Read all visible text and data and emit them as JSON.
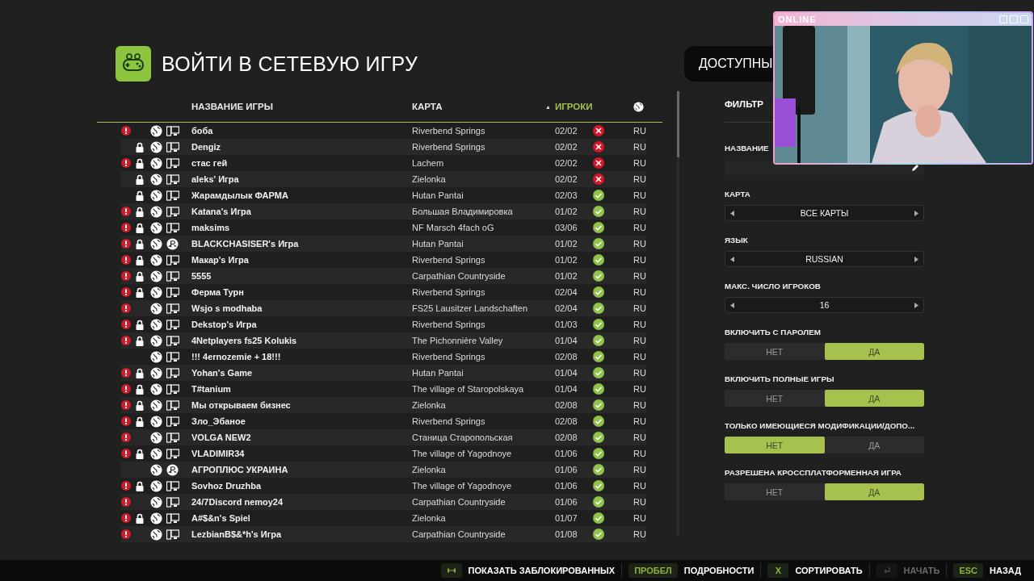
{
  "title": "ВОЙТИ В СЕТЕВУЮ ИГРУ",
  "tab": {
    "label": "ДОСТУПНЫ"
  },
  "table": {
    "columns": {
      "name": "НАЗВАНИЕ ИГРЫ",
      "map": "КАРТА",
      "sort_arrow": "▲",
      "players": "ИГРОКИ"
    },
    "sorted_by_players": true,
    "rows": [
      {
        "name": "боба",
        "map": "Riverbend Springs",
        "players": "02/02",
        "full": true,
        "warning": true,
        "locked": false,
        "console": false,
        "lang": "RU"
      },
      {
        "name": "Dengiz",
        "map": "Riverbend Springs",
        "players": "02/02",
        "full": true,
        "warning": false,
        "locked": true,
        "console": false,
        "lang": "RU"
      },
      {
        "name": "стас гей",
        "map": "Lachem",
        "players": "02/02",
        "full": true,
        "warning": true,
        "locked": true,
        "console": false,
        "lang": "RU"
      },
      {
        "name": "aleks' Игра",
        "map": "Zielonka",
        "players": "02/02",
        "full": true,
        "warning": false,
        "locked": true,
        "console": false,
        "lang": "RU"
      },
      {
        "name": "Жарамдылык ФАРМА",
        "map": "Hutan Pantai",
        "players": "02/03",
        "full": false,
        "warning": false,
        "locked": true,
        "console": false,
        "lang": "RU"
      },
      {
        "name": "Katana's Игра",
        "map": "Большая Владимировка",
        "players": "01/02",
        "full": false,
        "warning": true,
        "locked": true,
        "console": false,
        "lang": "RU"
      },
      {
        "name": "maksims",
        "map": "NF Marsch 4fach oG",
        "players": "03/06",
        "full": false,
        "warning": true,
        "locked": true,
        "console": false,
        "lang": "RU"
      },
      {
        "name": "BLACKCHASISER's Игра",
        "map": "Hutan Pantai",
        "players": "01/02",
        "full": false,
        "warning": true,
        "locked": true,
        "console": true,
        "lang": "RU"
      },
      {
        "name": "Макар's Игра",
        "map": "Riverbend Springs",
        "players": "01/02",
        "full": false,
        "warning": true,
        "locked": true,
        "console": false,
        "lang": "RU"
      },
      {
        "name": "5555",
        "map": "Carpathian Countryside",
        "players": "01/02",
        "full": false,
        "warning": true,
        "locked": true,
        "console": false,
        "lang": "RU"
      },
      {
        "name": "Ферма Турн",
        "map": "Riverbend Springs",
        "players": "02/04",
        "full": false,
        "warning": true,
        "locked": true,
        "console": false,
        "lang": "RU"
      },
      {
        "name": "Wsjo s modhaba",
        "map": "FS25 Lausitzer Landschaften",
        "players": "02/04",
        "full": false,
        "warning": true,
        "locked": false,
        "console": false,
        "lang": "RU"
      },
      {
        "name": "Dekstop's Игра",
        "map": "Riverbend Springs",
        "players": "01/03",
        "full": false,
        "warning": true,
        "locked": true,
        "console": false,
        "lang": "RU"
      },
      {
        "name": "4Netplayers fs25 Kolukis",
        "map": "The Pichonnière Valley",
        "players": "01/04",
        "full": false,
        "warning": true,
        "locked": true,
        "console": false,
        "lang": "RU"
      },
      {
        "name": "!!! 4ernozemie + 18!!!",
        "map": "Riverbend Springs",
        "players": "02/08",
        "full": false,
        "warning": false,
        "locked": false,
        "console": false,
        "lang": "RU"
      },
      {
        "name": "Yohan's Game",
        "map": "Hutan Pantai",
        "players": "01/04",
        "full": false,
        "warning": true,
        "locked": true,
        "console": false,
        "lang": "RU"
      },
      {
        "name": "T#tanium",
        "map": "The village of Staropolskaya",
        "players": "01/04",
        "full": false,
        "warning": true,
        "locked": true,
        "console": false,
        "lang": "RU"
      },
      {
        "name": "Мы открываем бизнес",
        "map": "Zielonka",
        "players": "02/08",
        "full": false,
        "warning": true,
        "locked": true,
        "console": false,
        "lang": "RU"
      },
      {
        "name": "Зло_Эбаное",
        "map": "Riverbend Springs",
        "players": "02/08",
        "full": false,
        "warning": true,
        "locked": true,
        "console": false,
        "lang": "RU"
      },
      {
        "name": "VOLGA NEW2",
        "map": "Станица Старопольская",
        "players": "02/08",
        "full": false,
        "warning": true,
        "locked": false,
        "console": false,
        "lang": "RU"
      },
      {
        "name": "VLADIMIR34",
        "map": "The village of Yagodnoye",
        "players": "01/06",
        "full": false,
        "warning": true,
        "locked": true,
        "console": false,
        "lang": "RU"
      },
      {
        "name": "АГРОПЛЮС УКРАИНА",
        "map": "Zielonka",
        "players": "01/06",
        "full": false,
        "warning": false,
        "locked": false,
        "console": true,
        "lang": "RU"
      },
      {
        "name": "Sovhoz Druzhba",
        "map": "The village of Yagodnoye",
        "players": "01/06",
        "full": false,
        "warning": true,
        "locked": true,
        "console": false,
        "lang": "RU"
      },
      {
        "name": "24/7Discord nemoy24",
        "map": "Carpathian Countryside",
        "players": "01/06",
        "full": false,
        "warning": true,
        "locked": false,
        "console": false,
        "lang": "RU"
      },
      {
        "name": "A#$&n's Spiel",
        "map": "Zielonka",
        "players": "01/07",
        "full": false,
        "warning": true,
        "locked": true,
        "console": false,
        "lang": "RU"
      },
      {
        "name": "LezbianB$&*h's Игра",
        "map": "Carpathian Countryside",
        "players": "01/08",
        "full": false,
        "warning": true,
        "locked": false,
        "console": false,
        "lang": "RU"
      }
    ]
  },
  "filters": {
    "title": "ФИЛЬТР",
    "name_label": "НАЗВАНИЕ",
    "selectors": [
      {
        "label": "КАРТА",
        "value": "ВСЕ КАРТЫ"
      },
      {
        "label": "ЯЗЫК",
        "value": "RUSSIAN"
      },
      {
        "label": "МАКС. ЧИСЛО ИГРОКОВ",
        "value": "16"
      }
    ],
    "toggles": [
      {
        "label": "ВКЛЮЧИТЬ С ПАРОЛЕМ",
        "options": [
          {
            "label": "НЕТ",
            "selected": false
          },
          {
            "label": "ДА",
            "selected": true
          }
        ]
      },
      {
        "label": "ВКЛЮЧИТЬ ПОЛНЫЕ ИГРЫ",
        "options": [
          {
            "label": "НЕТ",
            "selected": false
          },
          {
            "label": "ДА",
            "selected": true
          }
        ]
      },
      {
        "label": "ТОЛЬКО ИМЕЮЩИЕСЯ МОДИФИКАЦИИ/ДОПО...",
        "options": [
          {
            "label": "НЕТ",
            "selected": true
          },
          {
            "label": "ДА",
            "selected": false
          }
        ]
      },
      {
        "label": "РАЗРЕШЕНА КРОССПЛАТФОРМЕННАЯ ИГРА",
        "options": [
          {
            "label": "НЕТ",
            "selected": false
          },
          {
            "label": "ДА",
            "selected": true
          }
        ]
      }
    ]
  },
  "hints": [
    {
      "kind": "arrows",
      "label": "ПОКАЗАТЬ ЗАБЛОКИРОВАННЫХ",
      "disabled": false
    },
    {
      "kind": "key",
      "key": "ПРОБЕЛ",
      "label": "ПОДРОБНОСТИ",
      "disabled": false
    },
    {
      "kind": "key",
      "key": "X",
      "label": "СОРТИРОВАТЬ",
      "disabled": false
    },
    {
      "kind": "enter",
      "label": "НАЧАТЬ",
      "disabled": true
    },
    {
      "kind": "key",
      "key": "ESC",
      "label": "НАЗАД",
      "disabled": false
    }
  ],
  "overlay": {
    "title": "ONLINE",
    "kind": "picture"
  }
}
